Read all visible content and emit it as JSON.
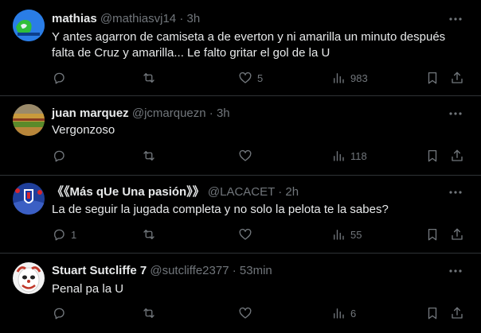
{
  "tweets": [
    {
      "name": "mathias",
      "handle": "@mathiasvj14",
      "sep": "·",
      "time": "3h",
      "lines": [
        "Y antes agarron de camiseta a de everton y ni amarilla un minuto después",
        "falta de Cruz y amarilla... Le falto gritar el gol de la U"
      ],
      "reply_count": "",
      "retweet_count": "",
      "like_count": "5",
      "view_count": "983"
    },
    {
      "name": "juan marquez",
      "handle": "@jcmarquezn",
      "sep": "·",
      "time": "3h",
      "lines": [
        "Vergonzoso"
      ],
      "reply_count": "",
      "retweet_count": "",
      "like_count": "",
      "view_count": "118"
    },
    {
      "name": "《《Más qUe Una pasión》》",
      "handle": "@LACACET",
      "sep": "·",
      "time": "2h",
      "lines": [
        "La de seguir la jugada completa y no solo la pelota te la sabes?"
      ],
      "reply_count": "1",
      "retweet_count": "",
      "like_count": "",
      "view_count": "55"
    },
    {
      "name": "Stuart Sutcliffe 7",
      "handle": "@sutcliffe2377",
      "sep": "·",
      "time": "53min",
      "lines": [
        "Penal pa la U"
      ],
      "reply_count": "",
      "retweet_count": "",
      "like_count": "",
      "view_count": "6"
    }
  ],
  "colors": {
    "background": "#000000",
    "text": "#e7e9ea",
    "muted": "#71767b",
    "divider": "#2f3336"
  },
  "icons": [
    "more-icon",
    "reply-icon",
    "retweet-icon",
    "like-icon",
    "views-icon",
    "bookmark-icon",
    "share-icon"
  ]
}
